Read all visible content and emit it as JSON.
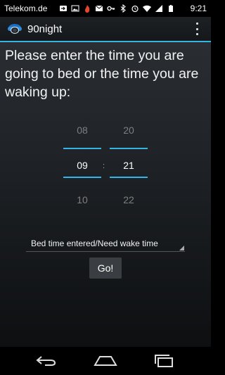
{
  "status_bar": {
    "carrier": "Telekom.de",
    "time": "9:21",
    "icons": [
      "notification-icon",
      "image-icon",
      "flame-icon",
      "gmail-icon",
      "key-icon",
      "bluetooth-icon",
      "alarm-icon",
      "wifi-icon",
      "signal-icon",
      "battery-icon"
    ]
  },
  "action_bar": {
    "title": "90night",
    "logo": "car-logo-icon",
    "overflow": "overflow-menu-icon"
  },
  "prompt": "Please enter the time you are going to bed or the time you are waking up:",
  "time_picker": {
    "hour": {
      "prev": "08",
      "current": "09",
      "next": "10"
    },
    "separator": ":",
    "minute": {
      "prev": "20",
      "current": "21",
      "next": "22"
    }
  },
  "mode_spinner": {
    "selected": "Bed time entered/Need wake time"
  },
  "go_button": {
    "label": "Go!"
  },
  "nav": {
    "back": "back-icon",
    "home": "home-icon",
    "recents": "recents-icon"
  },
  "colors": {
    "accent": "#34b5e5",
    "background": "#000000"
  }
}
